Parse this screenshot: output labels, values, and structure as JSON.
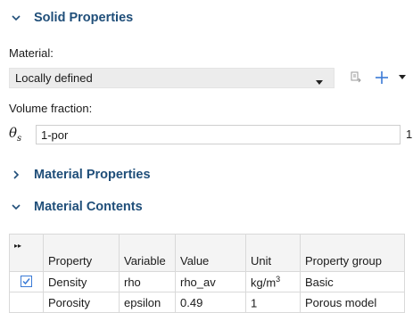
{
  "sections": {
    "solid_properties": "Solid Properties",
    "material_properties": "Material Properties",
    "material_contents": "Material Contents"
  },
  "material": {
    "label": "Material:",
    "selected": "Locally defined"
  },
  "volume_fraction": {
    "label": "Volume fraction:",
    "symbol": "θ",
    "subscript": "s",
    "value": "1-por",
    "unit": "1"
  },
  "table": {
    "corner": "▸▸",
    "headers": [
      "Property",
      "Variable",
      "Value",
      "Unit",
      "Property group"
    ],
    "rows": [
      {
        "checked": true,
        "property": "Density",
        "variable": "rho",
        "value": "rho_av",
        "unit_base": "kg/m",
        "unit_sup": "3",
        "group": "Basic"
      },
      {
        "checked": false,
        "property": "Porosity",
        "variable": "epsilon",
        "value": "0.49",
        "unit_base": "1",
        "unit_sup": "",
        "group": "Porous model"
      }
    ]
  },
  "colors": {
    "section_title": "#1f4e79",
    "accent": "#3a7ad6"
  }
}
